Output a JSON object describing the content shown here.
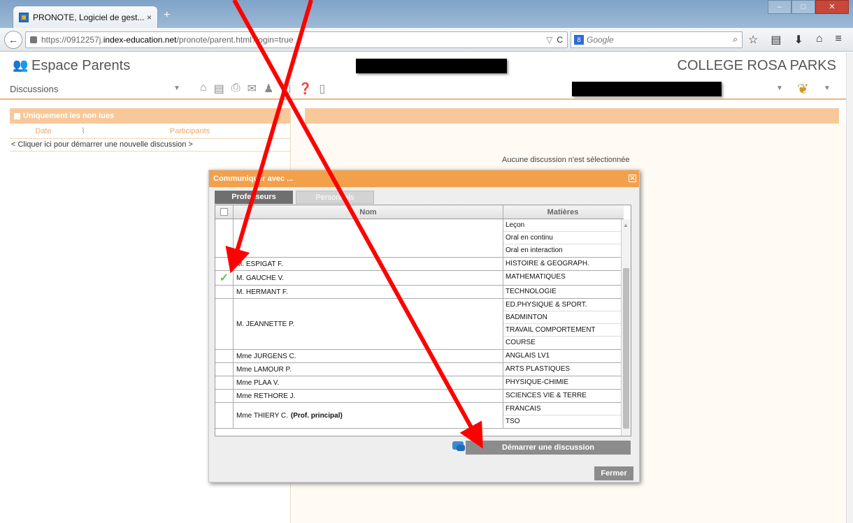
{
  "browser": {
    "tab_title": "PRONOTE, Logiciel de gest...",
    "tab_close": "×",
    "new_tab": "+",
    "url_prefix": "https://0912257j.",
    "url_domain": "index-education.net",
    "url_suffix": "/pronote/parent.html?login=true",
    "search_placeholder": "Google"
  },
  "app": {
    "title": "Espace Parents",
    "school": "COLLEGE ROSA PARKS",
    "section_select": "Discussions"
  },
  "left_pane": {
    "filter_label": "Uniquement les non lues",
    "col_date": "Date",
    "col_participants": "Participants",
    "new_discussion": "< Cliquer ici pour démarrer une nouvelle discussion >"
  },
  "right_pane": {
    "empty_message": "Aucune discussion n'est sélectionnée"
  },
  "dialog": {
    "title": "Communiquer avec ...",
    "tabs": [
      "Professeurs",
      "Personnels"
    ],
    "col_name": "Nom",
    "col_subjects": "Matières",
    "rows": [
      {
        "name": "",
        "checked": false,
        "subjects": [
          "Leçon",
          "Oral en continu",
          "Oral en interaction"
        ]
      },
      {
        "name": "M. ESPIGAT F.",
        "checked": false,
        "subjects": [
          "HISTOIRE & GEOGRAPH."
        ]
      },
      {
        "name": "M. GAUCHE V.",
        "checked": true,
        "subjects": [
          "MATHEMATIQUES"
        ]
      },
      {
        "name": "M. HERMANT F.",
        "checked": false,
        "subjects": [
          "TECHNOLOGIE"
        ]
      },
      {
        "name": "M. JEANNETTE P.",
        "checked": false,
        "subjects": [
          "ED.PHYSIQUE & SPORT.",
          "BADMINTON",
          "TRAVAIL COMPORTEMENT",
          "COURSE"
        ]
      },
      {
        "name": "Mme JURGENS C.",
        "checked": false,
        "subjects": [
          "ANGLAIS LV1"
        ]
      },
      {
        "name": "Mme LAMOUR P.",
        "checked": false,
        "subjects": [
          "ARTS PLASTIQUES"
        ]
      },
      {
        "name": "Mme PLAA V.",
        "checked": false,
        "subjects": [
          "PHYSIQUE-CHIMIE"
        ]
      },
      {
        "name": "Mme RETHORE J.",
        "checked": false,
        "subjects": [
          "SCIENCES VIE & TERRE"
        ]
      },
      {
        "name": "Mme THIERY C.",
        "name_suffix": "(Prof. principal)",
        "checked": false,
        "subjects": [
          "FRANCAIS",
          "TSO"
        ]
      }
    ],
    "start_button": "Démarrer une discussion",
    "close_button": "Fermer"
  },
  "colors": {
    "accent_orange": "#f3a04c",
    "light_orange": "#f9c89a",
    "annotation_red": "#ff0000",
    "check_green": "#6cc04a"
  }
}
